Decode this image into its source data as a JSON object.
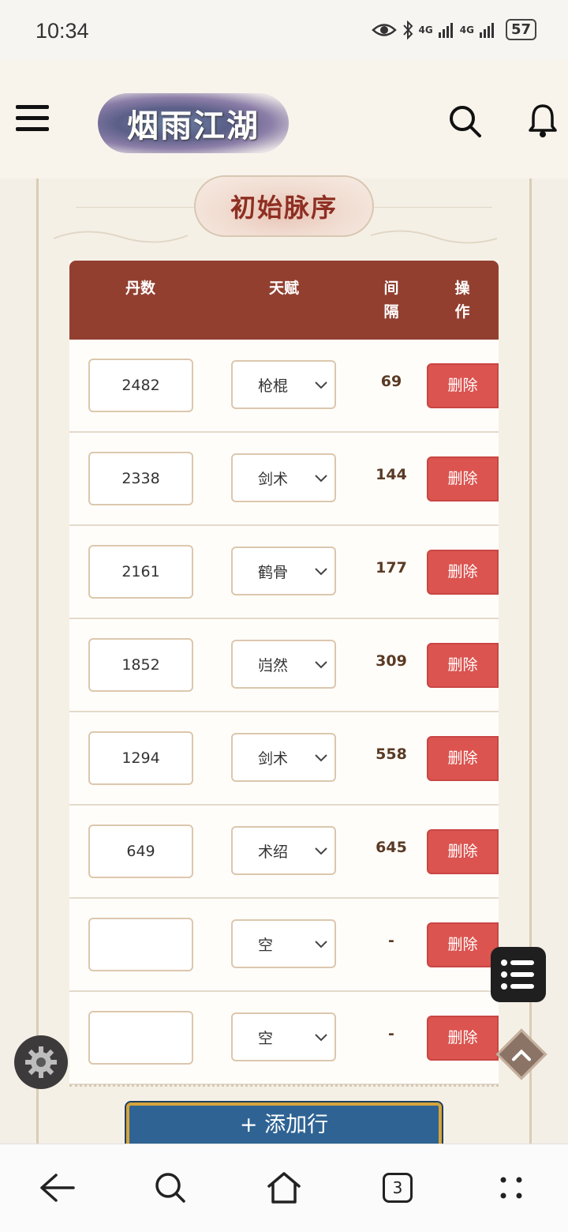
{
  "status_bar": {
    "time": "10:34",
    "network1": "4G",
    "network2": "4G",
    "battery": "57"
  },
  "header": {
    "logo_text": "烟雨江湖"
  },
  "section": {
    "title": "初始脉序"
  },
  "table": {
    "headers": {
      "dan": "丹数",
      "talent": "天赋",
      "interval": "间\n隔",
      "action": "操\n作"
    },
    "rows": [
      {
        "dan": "2482",
        "talent": "枪棍",
        "interval": "69",
        "action": "删除"
      },
      {
        "dan": "2338",
        "talent": "剑术",
        "interval": "144",
        "action": "删除"
      },
      {
        "dan": "2161",
        "talent": "鹤骨",
        "interval": "177",
        "action": "删除"
      },
      {
        "dan": "1852",
        "talent": "岿然",
        "interval": "309",
        "action": "删除"
      },
      {
        "dan": "1294",
        "talent": "剑术",
        "interval": "558",
        "action": "删除"
      },
      {
        "dan": "649",
        "talent": "术绍",
        "interval": "645",
        "action": "删除"
      },
      {
        "dan": "",
        "talent": "空",
        "interval": "-",
        "action": "删除"
      },
      {
        "dan": "",
        "talent": "空",
        "interval": "-",
        "action": "删除"
      }
    ]
  },
  "add_row_label": "+ 添加行",
  "nav": {
    "tabs_count": "3"
  },
  "icons": {
    "menu": "hamburger-icon",
    "search": "search-icon",
    "bell": "bell-icon",
    "chevron": "chevron-down-icon",
    "gear": "gear-icon",
    "list": "list-icon",
    "up": "chevron-up-icon",
    "back": "back-arrow-icon",
    "home": "home-icon",
    "more": "more-dots-icon"
  },
  "colors": {
    "header_bg": "#923f30",
    "delete_btn": "#db5450",
    "add_btn": "#2f6394",
    "add_btn_border": "#d6a43c",
    "title_text": "#8e2f22"
  }
}
